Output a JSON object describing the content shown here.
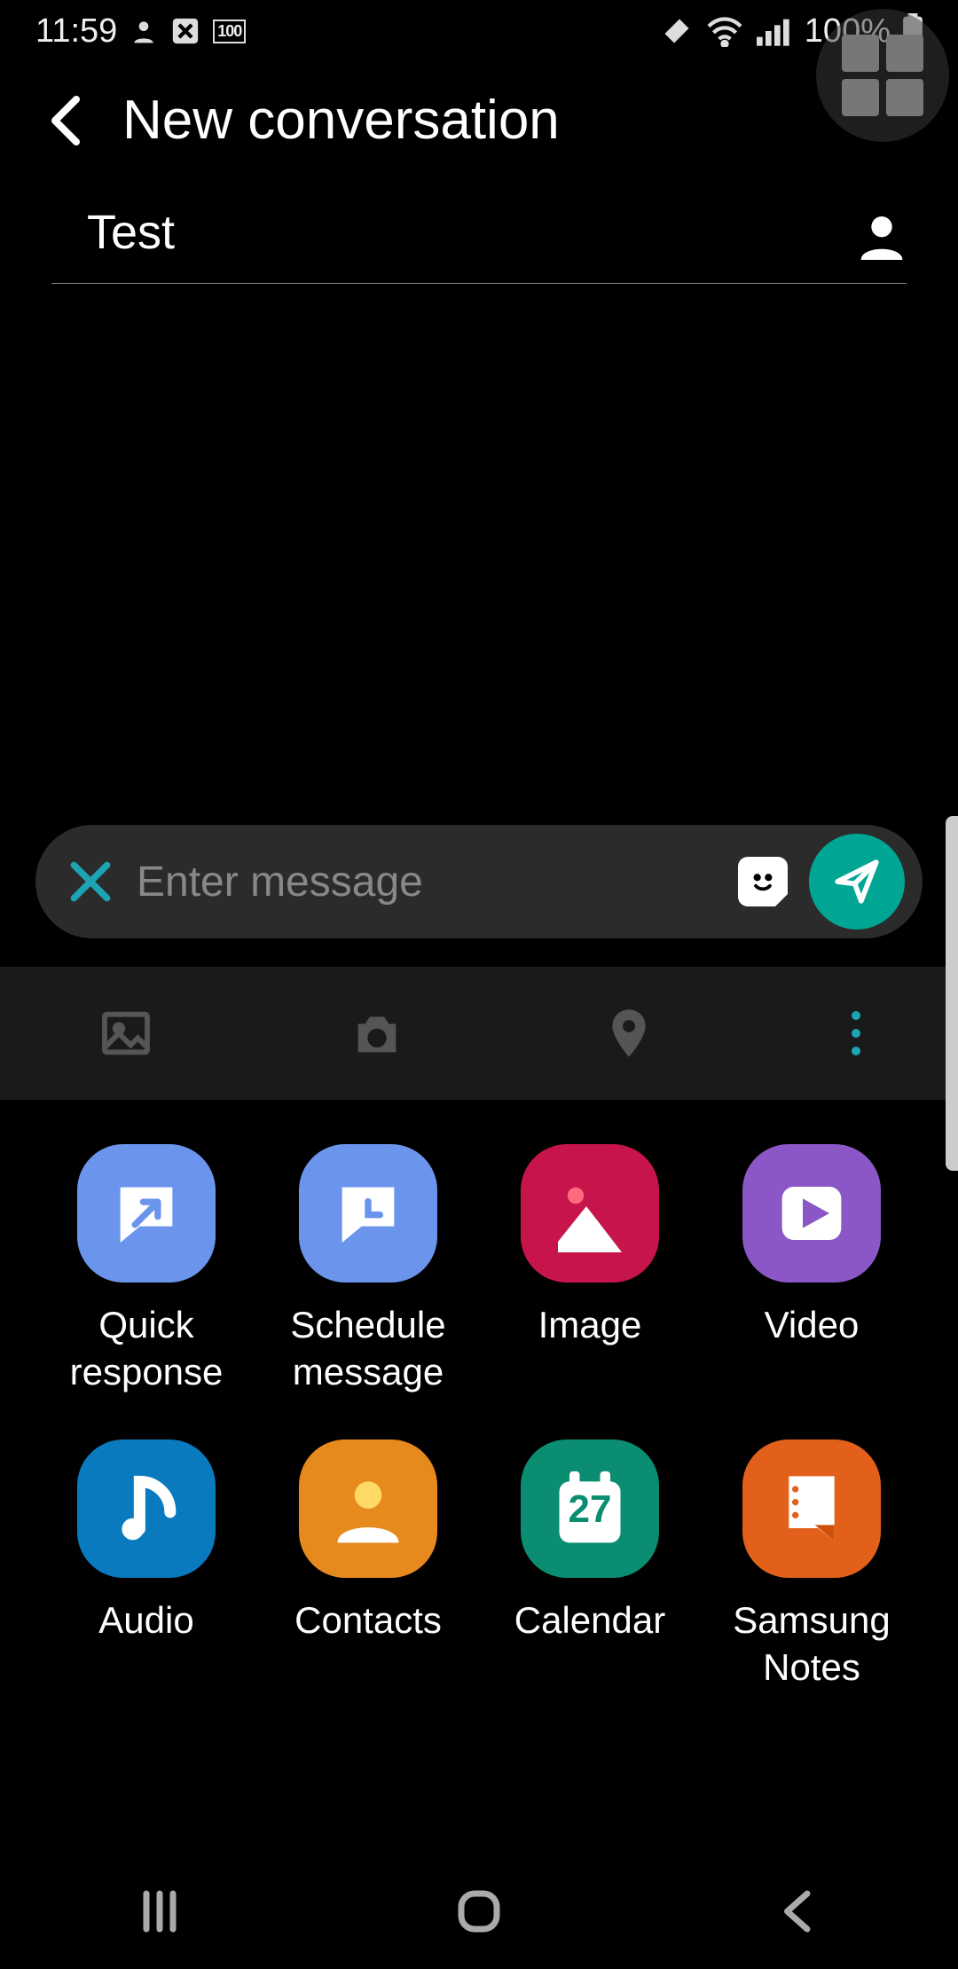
{
  "status": {
    "time": "11:59",
    "battery_text": "100%"
  },
  "header": {
    "title": "New conversation"
  },
  "recipient": {
    "value": "Test"
  },
  "message": {
    "placeholder": "Enter message"
  },
  "attachments": [
    {
      "label": "Quick\nresponse",
      "color": "#6b95ec",
      "name": "quick-response"
    },
    {
      "label": "Schedule\nmessage",
      "color": "#6b95ec",
      "name": "schedule-message"
    },
    {
      "label": "Image",
      "color": "#c7154c",
      "name": "image"
    },
    {
      "label": "Video",
      "color": "#8b57c7",
      "name": "video"
    },
    {
      "label": "Audio",
      "color": "#0a7abf",
      "name": "audio"
    },
    {
      "label": "Contacts",
      "color": "#e78a1e",
      "name": "contacts"
    },
    {
      "label": "Calendar",
      "color": "#0a8d70",
      "name": "calendar",
      "day": "27"
    },
    {
      "label": "Samsung\nNotes",
      "color": "#e2601a",
      "name": "samsung-notes"
    }
  ]
}
